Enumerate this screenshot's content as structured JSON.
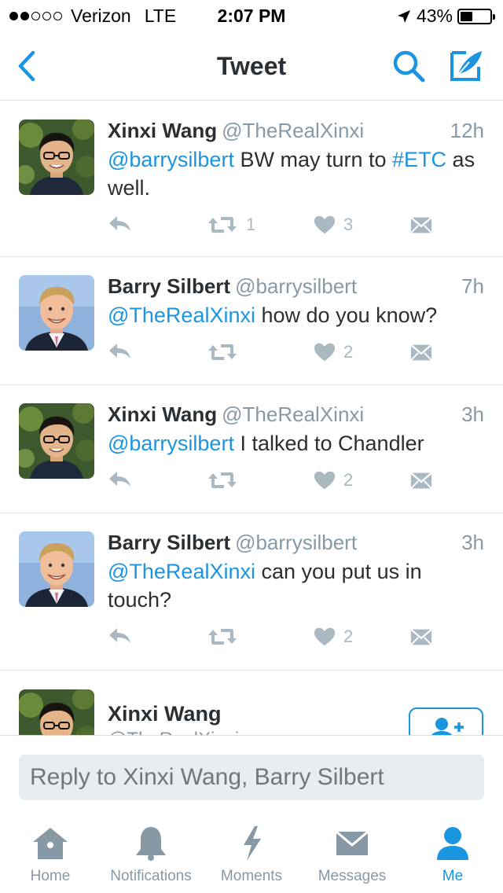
{
  "status_bar": {
    "carrier": "Verizon",
    "network": "LTE",
    "time": "2:07 PM",
    "battery": "43%",
    "battery_level": 0.43,
    "signal_bars": 2
  },
  "nav": {
    "title": "Tweet",
    "icons": [
      "back-chevron-icon",
      "search-icon",
      "compose-icon"
    ]
  },
  "colors": {
    "accent": "#1b95e0",
    "muted": "#8899a6",
    "action_icon": "#aab8c2"
  },
  "tweets": [
    {
      "name": "Xinxi Wang",
      "handle": "@TheRealXinxi",
      "time": "12h",
      "text_mention": "@barrysilbert",
      "text_middle": " BW may turn to ",
      "text_hashtag": "#ETC",
      "text_end": " as well.",
      "retweets": "1",
      "likes": "3"
    },
    {
      "name": "Barry Silbert",
      "handle": "@barrysilbert",
      "time": "7h",
      "text_mention": "@TheRealXinxi",
      "text_rest": " how do you know?",
      "likes": "2"
    },
    {
      "name": "Xinxi Wang",
      "handle": "@TheRealXinxi",
      "time": "3h",
      "text_mention": "@barrysilbert",
      "text_rest": " I talked to Chandler",
      "likes": "2"
    },
    {
      "name": "Barry Silbert",
      "handle": "@barrysilbert",
      "time": "3h",
      "text_mention": "@TheRealXinxi",
      "text_rest": " can you put us in touch?",
      "likes": "2"
    }
  ],
  "focused_tweet": {
    "name": "Xinxi Wang",
    "handle": "@TheRealXinxi"
  },
  "reply": {
    "placeholder": "Reply to Xinxi Wang, Barry Silbert"
  },
  "tabs": [
    {
      "label": "Home",
      "icon": "home-icon"
    },
    {
      "label": "Notifications",
      "icon": "bell-icon"
    },
    {
      "label": "Moments",
      "icon": "lightning-icon"
    },
    {
      "label": "Messages",
      "icon": "envelope-icon"
    },
    {
      "label": "Me",
      "icon": "person-icon",
      "active": true
    }
  ]
}
